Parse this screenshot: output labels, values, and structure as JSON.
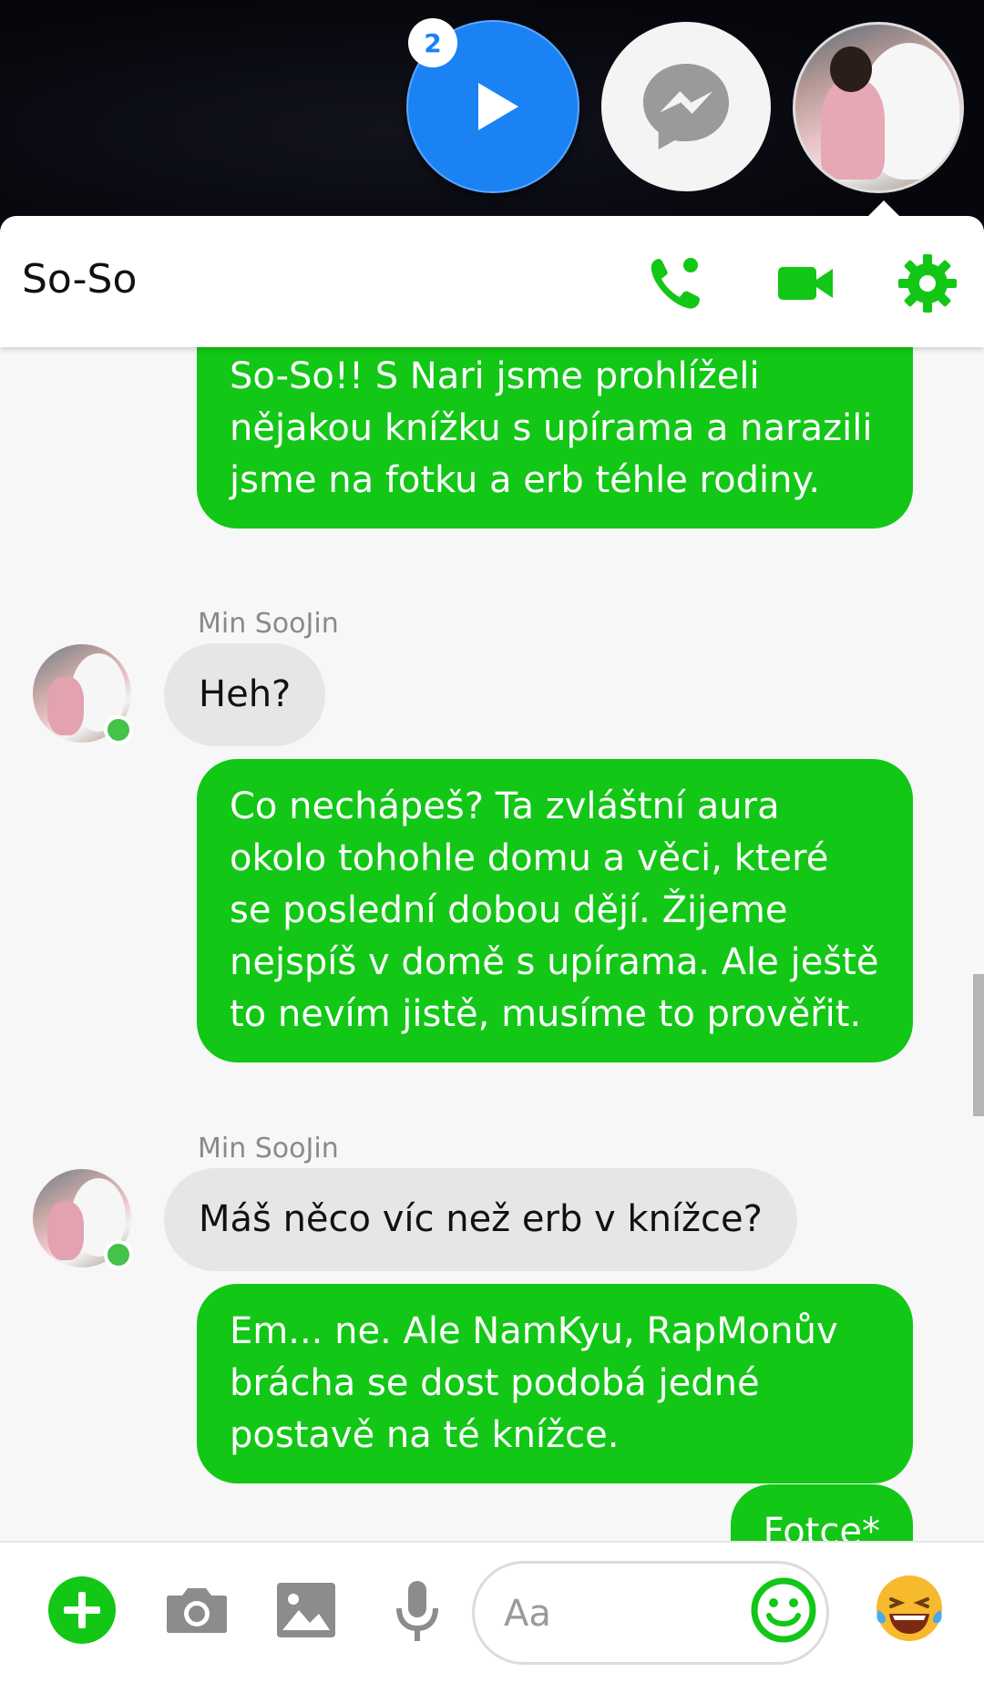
{
  "chat_heads": {
    "badge_count": "2"
  },
  "header": {
    "title": "So-So"
  },
  "messages": [
    {
      "type": "out",
      "text": "So-So!! S Nari jsme prohlíželi nějakou knížku s upírama a narazili jsme na fotku a erb téhle rodiny."
    },
    {
      "type": "in",
      "sender": "Min SooJin",
      "text": "Heh?"
    },
    {
      "type": "out",
      "text": "Co nechápeš? Ta zvláštní aura okolo tohohle domu a věci, které se poslední dobou dějí. Žijeme nejspíš v domě s upírama. Ale ještě to nevím jistě, musíme to prověřit."
    },
    {
      "type": "in",
      "sender": "Min SooJin",
      "text": "Máš něco víc než erb v knížce?"
    },
    {
      "type": "out",
      "text": "Em... ne. Ale NamKyu, RapMonův brácha se dost podobá jedné postavě na té knížce."
    },
    {
      "type": "out",
      "text": "Fotce*"
    }
  ],
  "composer": {
    "placeholder": "Aa"
  },
  "colors": {
    "accent": "#12c716",
    "outgoing_bubble": "#12c716",
    "incoming_bubble": "#e6e6e6",
    "chat_head_blue": "#1b82f4"
  }
}
